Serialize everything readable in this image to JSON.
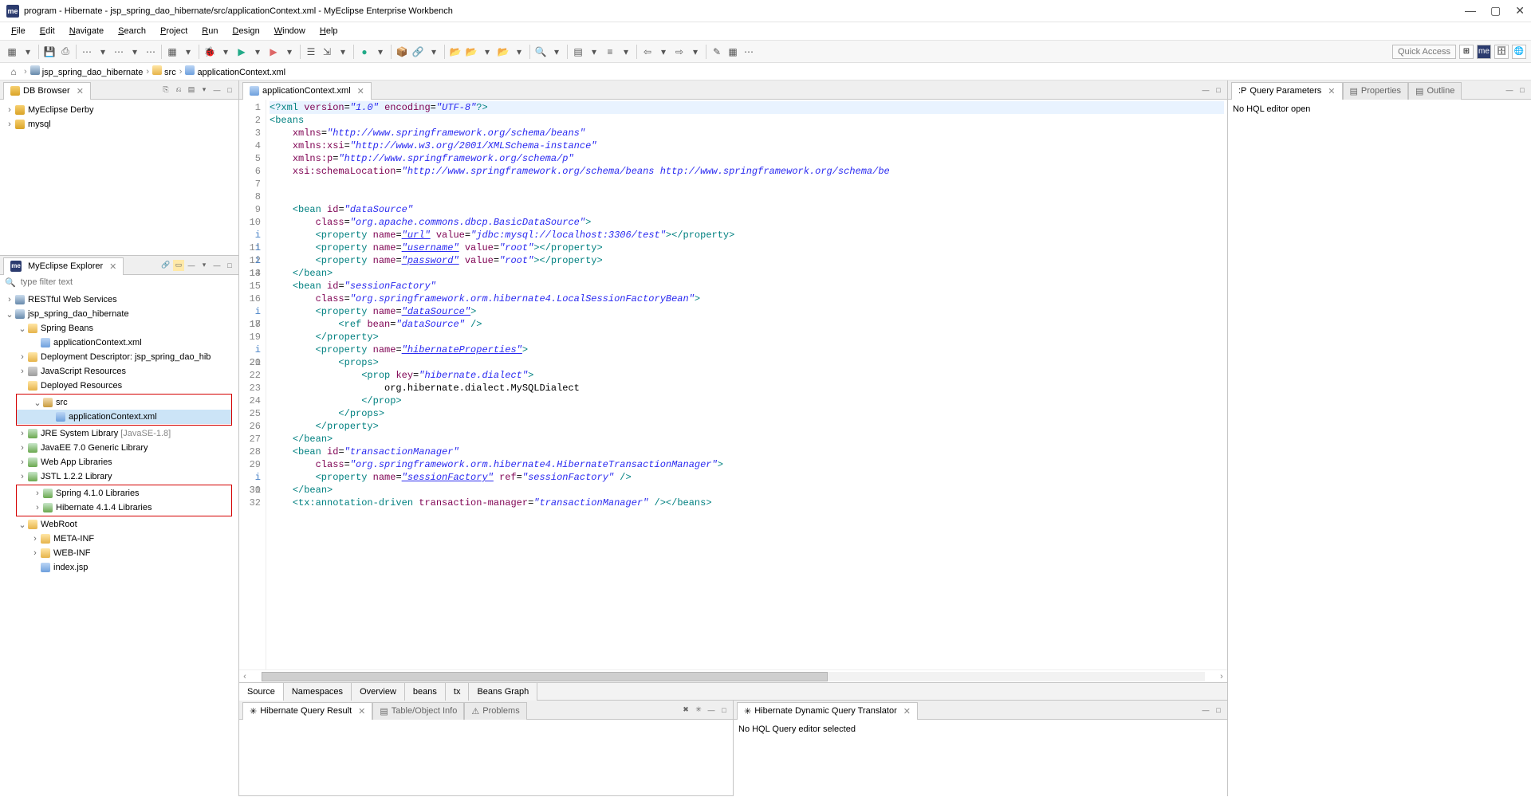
{
  "title": "program - Hibernate - jsp_spring_dao_hibernate/src/applicationContext.xml - MyEclipse Enterprise Workbench",
  "menubar": [
    "File",
    "Edit",
    "Navigate",
    "Search",
    "Project",
    "Run",
    "Design",
    "Window",
    "Help"
  ],
  "quick_access": "Quick Access",
  "breadcrumb": {
    "items": [
      {
        "icon": "prj",
        "label": "jsp_spring_dao_hibernate"
      },
      {
        "icon": "fld",
        "label": "src"
      },
      {
        "icon": "xml",
        "label": "applicationContext.xml"
      }
    ]
  },
  "dbbrowser": {
    "title": "DB Browser",
    "items": [
      {
        "label": "MyEclipse Derby"
      },
      {
        "label": "mysql"
      }
    ]
  },
  "explorer": {
    "title": "MyEclipse Explorer",
    "filter_placeholder": "type filter text",
    "nodes": [
      {
        "tw": ">",
        "ic": "prj",
        "label": "RESTful Web Services",
        "class": ""
      },
      {
        "tw": "v",
        "ic": "prj",
        "label": "jsp_spring_dao_hibernate"
      },
      {
        "indent": 1,
        "tw": "v",
        "ic": "fld",
        "label": "Spring Beans"
      },
      {
        "indent": 2,
        "tw": "",
        "ic": "xml",
        "label": "applicationContext.xml"
      },
      {
        "indent": 1,
        "tw": ">",
        "ic": "fld",
        "label": "Deployment Descriptor: jsp_spring_dao_hib"
      },
      {
        "indent": 1,
        "tw": ">",
        "ic": "lib",
        "label": "JavaScript Resources"
      },
      {
        "indent": 1,
        "tw": "",
        "ic": "fld",
        "label": "Deployed Resources"
      }
    ],
    "redbox1": [
      {
        "indent": 1,
        "tw": "v",
        "ic": "pkg",
        "label": "src"
      },
      {
        "indent": 2,
        "tw": "",
        "ic": "xml",
        "label": "applicationContext.xml",
        "sel": true
      }
    ],
    "after1": [
      {
        "indent": 1,
        "tw": ">",
        "ic": "jar",
        "label": "JRE System Library",
        "suffix": "[JavaSE-1.8]"
      },
      {
        "indent": 1,
        "tw": ">",
        "ic": "jar",
        "label": "JavaEE 7.0 Generic Library"
      },
      {
        "indent": 1,
        "tw": ">",
        "ic": "jar",
        "label": "Web App Libraries"
      },
      {
        "indent": 1,
        "tw": ">",
        "ic": "jar",
        "label": "JSTL 1.2.2 Library"
      }
    ],
    "redbox2": [
      {
        "indent": 1,
        "tw": ">",
        "ic": "jar",
        "label": "Spring 4.1.0 Libraries"
      },
      {
        "indent": 1,
        "tw": ">",
        "ic": "jar",
        "label": "Hibernate 4.1.4 Libraries"
      }
    ],
    "after2": [
      {
        "indent": 1,
        "tw": "v",
        "ic": "fld",
        "label": "WebRoot"
      },
      {
        "indent": 2,
        "tw": ">",
        "ic": "fld",
        "label": "META-INF"
      },
      {
        "indent": 2,
        "tw": ">",
        "ic": "fld",
        "label": "WEB-INF"
      },
      {
        "indent": 2,
        "tw": "",
        "ic": "xml",
        "label": "index.jsp"
      }
    ]
  },
  "editor": {
    "tab": "applicationContext.xml",
    "bottomtabs": [
      "Source",
      "Namespaces",
      "Overview",
      "beans",
      "tx",
      "Beans Graph"
    ],
    "lines": [
      {
        "n": 1,
        "info": false,
        "html": "<span class='tag'>&lt;?xml</span> <span class='an'>version</span>=<span class='av'>\"1.0\"</span> <span class='an'>encoding</span>=<span class='av'>\"UTF-8\"</span><span class='tag'>?&gt;</span>"
      },
      {
        "n": 2,
        "info": false,
        "html": "<span class='tag'>&lt;beans</span>"
      },
      {
        "n": 3,
        "info": false,
        "html": "    <span class='an'>xmlns</span>=<span class='av'>\"http://www.springframework.org/schema/beans\"</span>"
      },
      {
        "n": 4,
        "info": false,
        "html": "    <span class='an'>xmlns:xsi</span>=<span class='av'>\"http://www.w3.org/2001/XMLSchema-instance\"</span>"
      },
      {
        "n": 5,
        "info": false,
        "html": "    <span class='an'>xmlns:p</span>=<span class='av'>\"http://www.springframework.org/schema/p\"</span>"
      },
      {
        "n": 6,
        "info": false,
        "html": "    <span class='an'>xsi:schemaLocation</span>=<span class='av'>\"http://www.springframework.org/schema/beans http://www.springframework.org/schema/be</span>"
      },
      {
        "n": 7,
        "info": false,
        "html": ""
      },
      {
        "n": 8,
        "info": false,
        "html": ""
      },
      {
        "n": 9,
        "info": false,
        "html": "    <span class='tag'>&lt;bean</span> <span class='an'>id</span>=<span class='av'>\"dataSource\"</span>"
      },
      {
        "n": 10,
        "info": false,
        "html": "        <span class='an'>class</span>=<span class='av'>\"org.apache.commons.dbcp.BasicDataSource\"</span><span class='tag'>&gt;</span>"
      },
      {
        "n": 11,
        "info": true,
        "html": "        <span class='tag'>&lt;property</span> <span class='an'>name</span>=<span class='av u'>\"url\"</span> <span class='an'>value</span>=<span class='av'>\"jdbc:mysql://localhost:3306/test\"</span><span class='tag'>&gt;&lt;/property&gt;</span>"
      },
      {
        "n": 12,
        "info": true,
        "html": "        <span class='tag'>&lt;property</span> <span class='an'>name</span>=<span class='av u'>\"username\"</span> <span class='an'>value</span>=<span class='av'>\"root\"</span><span class='tag'>&gt;&lt;/property&gt;</span>"
      },
      {
        "n": 13,
        "info": true,
        "html": "        <span class='tag'>&lt;property</span> <span class='an'>name</span>=<span class='av u'>\"password\"</span> <span class='an'>value</span>=<span class='av'>\"root\"</span><span class='tag'>&gt;&lt;/property&gt;</span>"
      },
      {
        "n": 14,
        "info": false,
        "html": "    <span class='tag'>&lt;/bean&gt;</span>"
      },
      {
        "n": 15,
        "info": false,
        "html": "    <span class='tag'>&lt;bean</span> <span class='an'>id</span>=<span class='av'>\"sessionFactory\"</span>"
      },
      {
        "n": 16,
        "info": false,
        "html": "        <span class='an'>class</span>=<span class='av'>\"org.springframework.orm.hibernate4.LocalSessionFactoryBean\"</span><span class='tag'>&gt;</span>"
      },
      {
        "n": 17,
        "info": true,
        "html": "        <span class='tag'>&lt;property</span> <span class='an'>name</span>=<span class='av u'>\"dataSource\"</span><span class='tag'>&gt;</span>"
      },
      {
        "n": 18,
        "info": false,
        "html": "            <span class='tag'>&lt;ref</span> <span class='an'>bean</span>=<span class='av'>\"dataSource\"</span> <span class='tag'>/&gt;</span>"
      },
      {
        "n": 19,
        "info": false,
        "html": "        <span class='tag'>&lt;/property&gt;</span>"
      },
      {
        "n": 20,
        "info": true,
        "html": "        <span class='tag'>&lt;property</span> <span class='an'>name</span>=<span class='av u'>\"hibernateProperties\"</span><span class='tag'>&gt;</span>"
      },
      {
        "n": 21,
        "info": false,
        "html": "            <span class='tag'>&lt;props&gt;</span>"
      },
      {
        "n": 22,
        "info": false,
        "html": "                <span class='tag'>&lt;prop</span> <span class='an'>key</span>=<span class='av'>\"hibernate.dialect\"</span><span class='tag'>&gt;</span>"
      },
      {
        "n": 23,
        "info": false,
        "html": "                    <span class='txt'>org.hibernate.dialect.MySQLDialect</span>"
      },
      {
        "n": 24,
        "info": false,
        "html": "                <span class='tag'>&lt;/prop&gt;</span>"
      },
      {
        "n": 25,
        "info": false,
        "html": "            <span class='tag'>&lt;/props&gt;</span>"
      },
      {
        "n": 26,
        "info": false,
        "html": "        <span class='tag'>&lt;/property&gt;</span>"
      },
      {
        "n": 27,
        "info": false,
        "html": "    <span class='tag'>&lt;/bean&gt;</span>"
      },
      {
        "n": 28,
        "info": false,
        "html": "    <span class='tag'>&lt;bean</span> <span class='an'>id</span>=<span class='av'>\"transactionManager\"</span>"
      },
      {
        "n": 29,
        "info": false,
        "html": "        <span class='an'>class</span>=<span class='av'>\"org.springframework.orm.hibernate4.HibernateTransactionManager\"</span><span class='tag'>&gt;</span>"
      },
      {
        "n": 30,
        "info": true,
        "html": "        <span class='tag'>&lt;property</span> <span class='an'>name</span>=<span class='av u'>\"sessionFactory\"</span> <span class='an'>ref</span>=<span class='av'>\"sessionFactory\"</span> <span class='tag'>/&gt;</span>"
      },
      {
        "n": 31,
        "info": false,
        "html": "    <span class='tag'>&lt;/bean&gt;</span>"
      },
      {
        "n": 32,
        "info": false,
        "html": "    <span class='tag'>&lt;tx:annotation-driven</span> <span class='an'>transaction-manager</span>=<span class='av'>\"transactionManager\"</span> <span class='tag'>/&gt;&lt;/beans&gt;</span>"
      }
    ]
  },
  "hqr": {
    "title": "Hibernate Query Result"
  },
  "toi": {
    "title": "Table/Object Info"
  },
  "problems": {
    "title": "Problems"
  },
  "hdqt": {
    "title": "Hibernate Dynamic Query Translator",
    "body": "No HQL Query editor selected"
  },
  "qparams": {
    "title": "Query Parameters",
    "body": "No HQL editor open"
  },
  "properties": {
    "title": "Properties"
  },
  "outline": {
    "title": "Outline"
  }
}
